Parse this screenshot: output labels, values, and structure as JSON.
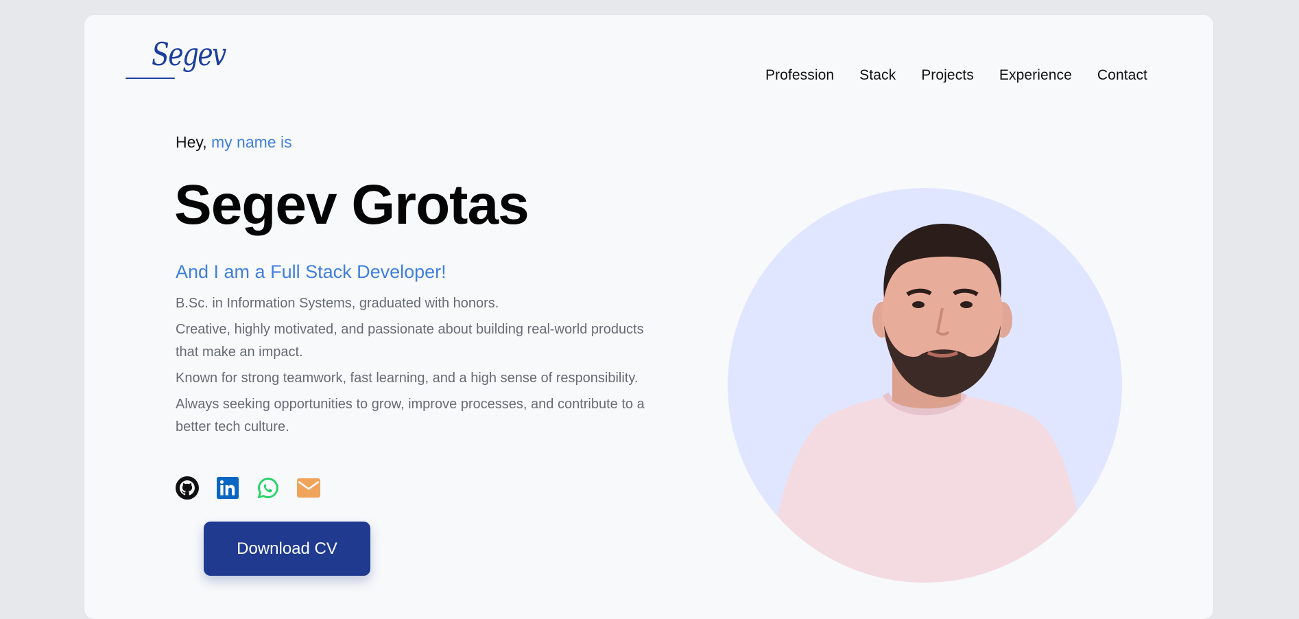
{
  "header": {
    "logo_text": "Segev",
    "nav": [
      "Profession",
      "Stack",
      "Projects",
      "Experience",
      "Contact"
    ]
  },
  "hero": {
    "greeting_prefix": "Hey,",
    "greeting_accent": "my name is",
    "name": "Segev Grotas",
    "role": "And I am a Full Stack Developer!",
    "bio": [
      "B.Sc. in Information Systems, graduated with honors.",
      "Creative, highly motivated, and passionate about building real-world products that make an impact.",
      "Known for strong teamwork, fast learning, and a high sense of responsibility.",
      "Always seeking opportunities to grow, improve processes, and contribute to a better tech culture."
    ],
    "socials": [
      "github-icon",
      "linkedin-icon",
      "whatsapp-icon",
      "email-icon"
    ],
    "cv_button": "Download CV"
  },
  "colors": {
    "accent": "#3f7fe0",
    "primary": "#1f3a8f",
    "avatar_bg": "#e0e6ff",
    "github": "#111111",
    "linkedin": "#0a66c2",
    "whatsapp": "#25d366",
    "email": "#f0a35a"
  }
}
